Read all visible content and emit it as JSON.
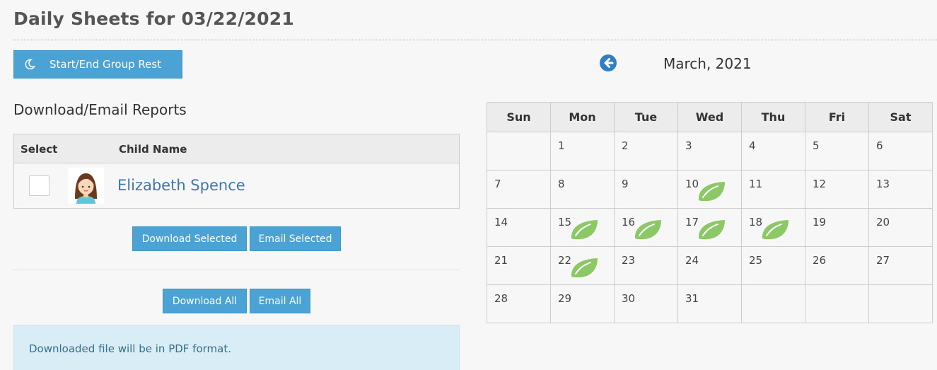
{
  "page": {
    "title": "Daily Sheets for 03/22/2021"
  },
  "rest_button": {
    "label": "Start/End Group Rest",
    "icon": "moon-icon"
  },
  "reports": {
    "title": "Download/Email Reports",
    "columns": {
      "select": "Select",
      "child_name": "Child Name"
    },
    "children": [
      {
        "name": "Elizabeth Spence",
        "selected": false
      }
    ],
    "download_selected": "Download Selected",
    "email_selected": "Email Selected",
    "download_all": "Download All",
    "email_all": "Email All",
    "info": "Downloaded file will be in PDF format."
  },
  "calendar": {
    "month_label": "March, 2021",
    "weekdays": [
      "Sun",
      "Mon",
      "Tue",
      "Wed",
      "Thu",
      "Fri",
      "Sat"
    ],
    "weeks": [
      [
        "",
        "1",
        "2",
        "3",
        "4",
        "5",
        "6"
      ],
      [
        "7",
        "8",
        "9",
        "10",
        "11",
        "12",
        "13"
      ],
      [
        "14",
        "15",
        "16",
        "17",
        "18",
        "19",
        "20"
      ],
      [
        "21",
        "22",
        "23",
        "24",
        "25",
        "26",
        "27"
      ],
      [
        "28",
        "29",
        "30",
        "31",
        "",
        "",
        ""
      ]
    ],
    "marked_days": [
      "10",
      "15",
      "16",
      "17",
      "18",
      "22"
    ],
    "marker_icon": "leaf-icon",
    "marker_color": "#8cc866"
  },
  "colors": {
    "primary_button": "#4aa3d4",
    "link": "#3a78b7",
    "info_bg": "#d9edf7",
    "prev_arrow": "#2e7fc4"
  }
}
